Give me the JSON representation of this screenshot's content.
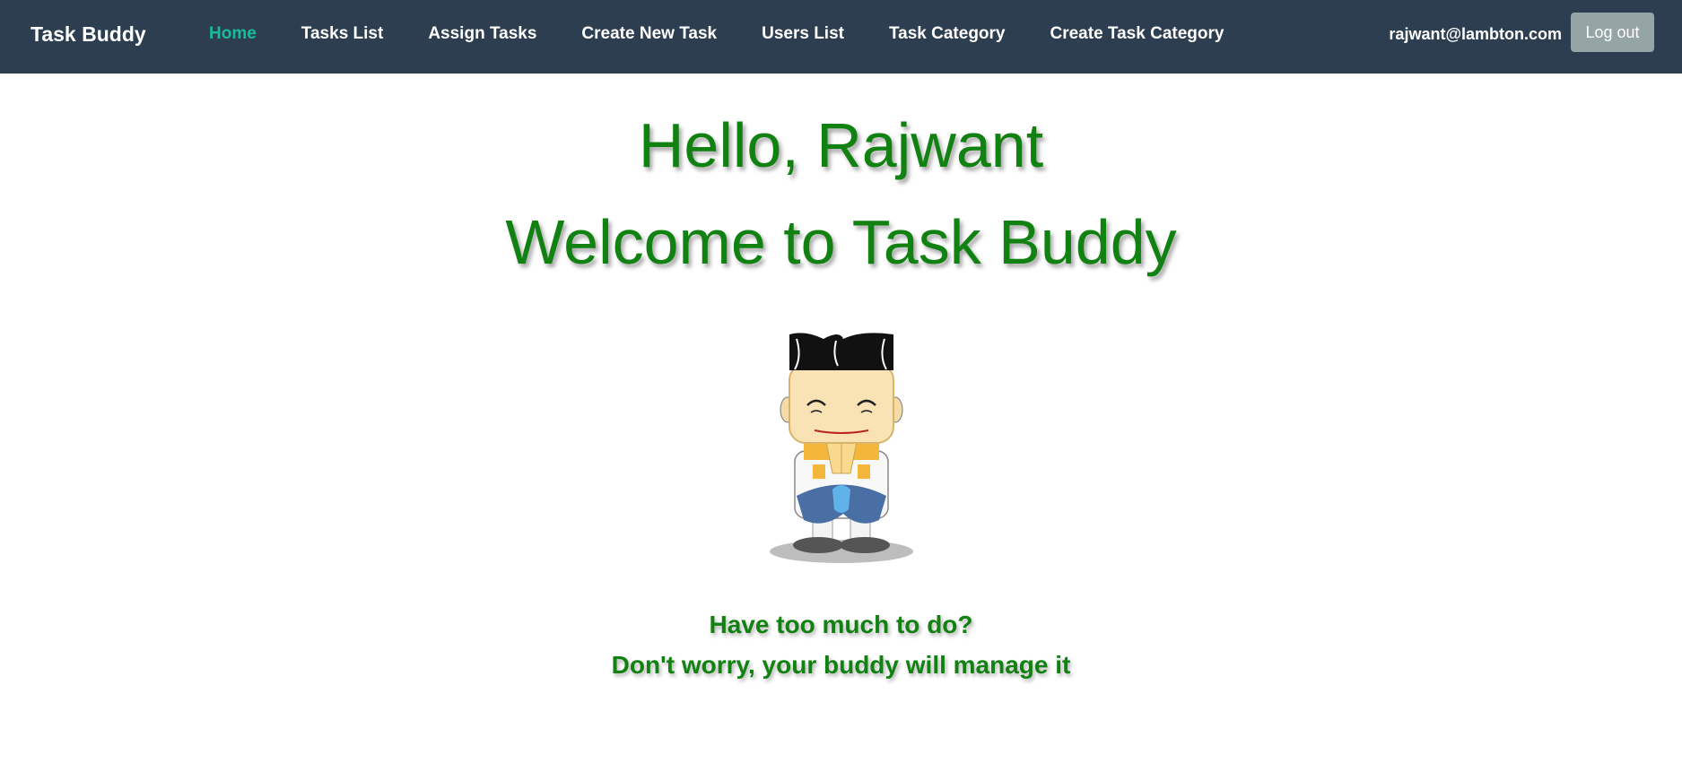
{
  "navbar": {
    "brand": "Task Buddy",
    "links": [
      {
        "label": "Home",
        "active": true
      },
      {
        "label": "Tasks List",
        "active": false
      },
      {
        "label": "Assign Tasks",
        "active": false
      },
      {
        "label": "Create New Task",
        "active": false
      },
      {
        "label": "Users List",
        "active": false
      },
      {
        "label": "Task Category",
        "active": false
      },
      {
        "label": "Create Task Category",
        "active": false
      }
    ],
    "user_email": "rajwant@lambton.com",
    "logout_label": "Log out"
  },
  "main": {
    "greeting": "Hello, Rajwant",
    "welcome": "Welcome to Task Buddy",
    "mascot_icon": "namaste-mascot-icon",
    "tagline_line1": "Have too much to do?",
    "tagline_line2": "Don't worry, your buddy will manage it"
  },
  "colors": {
    "navbar_bg": "#2c3e50",
    "active_link": "#18bc9c",
    "heading_green": "#118212",
    "logout_bg": "#95a5a6"
  }
}
